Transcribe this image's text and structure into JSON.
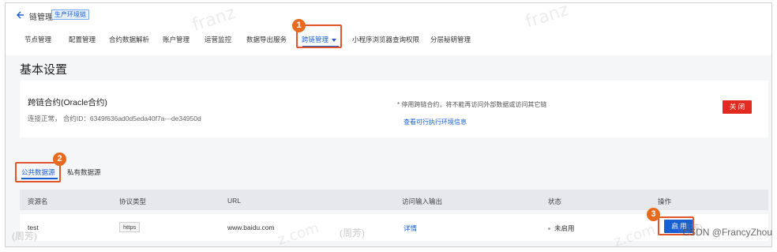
{
  "header": {
    "back_icon": "arrow-left-icon",
    "title": "链管理",
    "env_tag": "生产环境链"
  },
  "nav": {
    "items": [
      {
        "label": "节点管理"
      },
      {
        "label": "配置管理"
      },
      {
        "label": "合约数据解析"
      },
      {
        "label": "账户管理"
      },
      {
        "label": "运营监控"
      },
      {
        "label": "数据导出服务"
      },
      {
        "label": "跨链管理"
      },
      {
        "label": "小程序浏览器查询权限"
      },
      {
        "label": "分层秘钥管理"
      }
    ],
    "active_index": 6
  },
  "annotations": [
    "1",
    "2",
    "3"
  ],
  "page": {
    "title": "基本设置"
  },
  "contract": {
    "name": "跨链合约(Oracle合约)",
    "meta": "连接正常，  合约ID：6349f636ad0d5eda40f7a---de34950d",
    "note": "* 停用跨链合约，将不能再访问外部数据或访问其它链",
    "env_link": "查看可行执行环境信息",
    "close_button": "关 闭"
  },
  "data_source_tabs": {
    "public": "公共数据源",
    "private": "私有数据源"
  },
  "table": {
    "columns": [
      "资源名",
      "协议类型",
      "URL",
      "访问输入输出",
      "状态",
      "操作"
    ],
    "rows": [
      {
        "name": "test",
        "protocol": "https",
        "url": "www.baidu.com",
        "io": "详情",
        "status": "未启用",
        "action": "启 用"
      }
    ]
  },
  "watermarks": {
    "brand": "franz",
    "author": "(周芳)",
    "domain": "z.com",
    "csdn": "CSDN @FrancyZhou"
  },
  "colors": {
    "primary": "#1a5fd0",
    "danger": "#e22b1e",
    "annotation": "#e66b1f"
  }
}
